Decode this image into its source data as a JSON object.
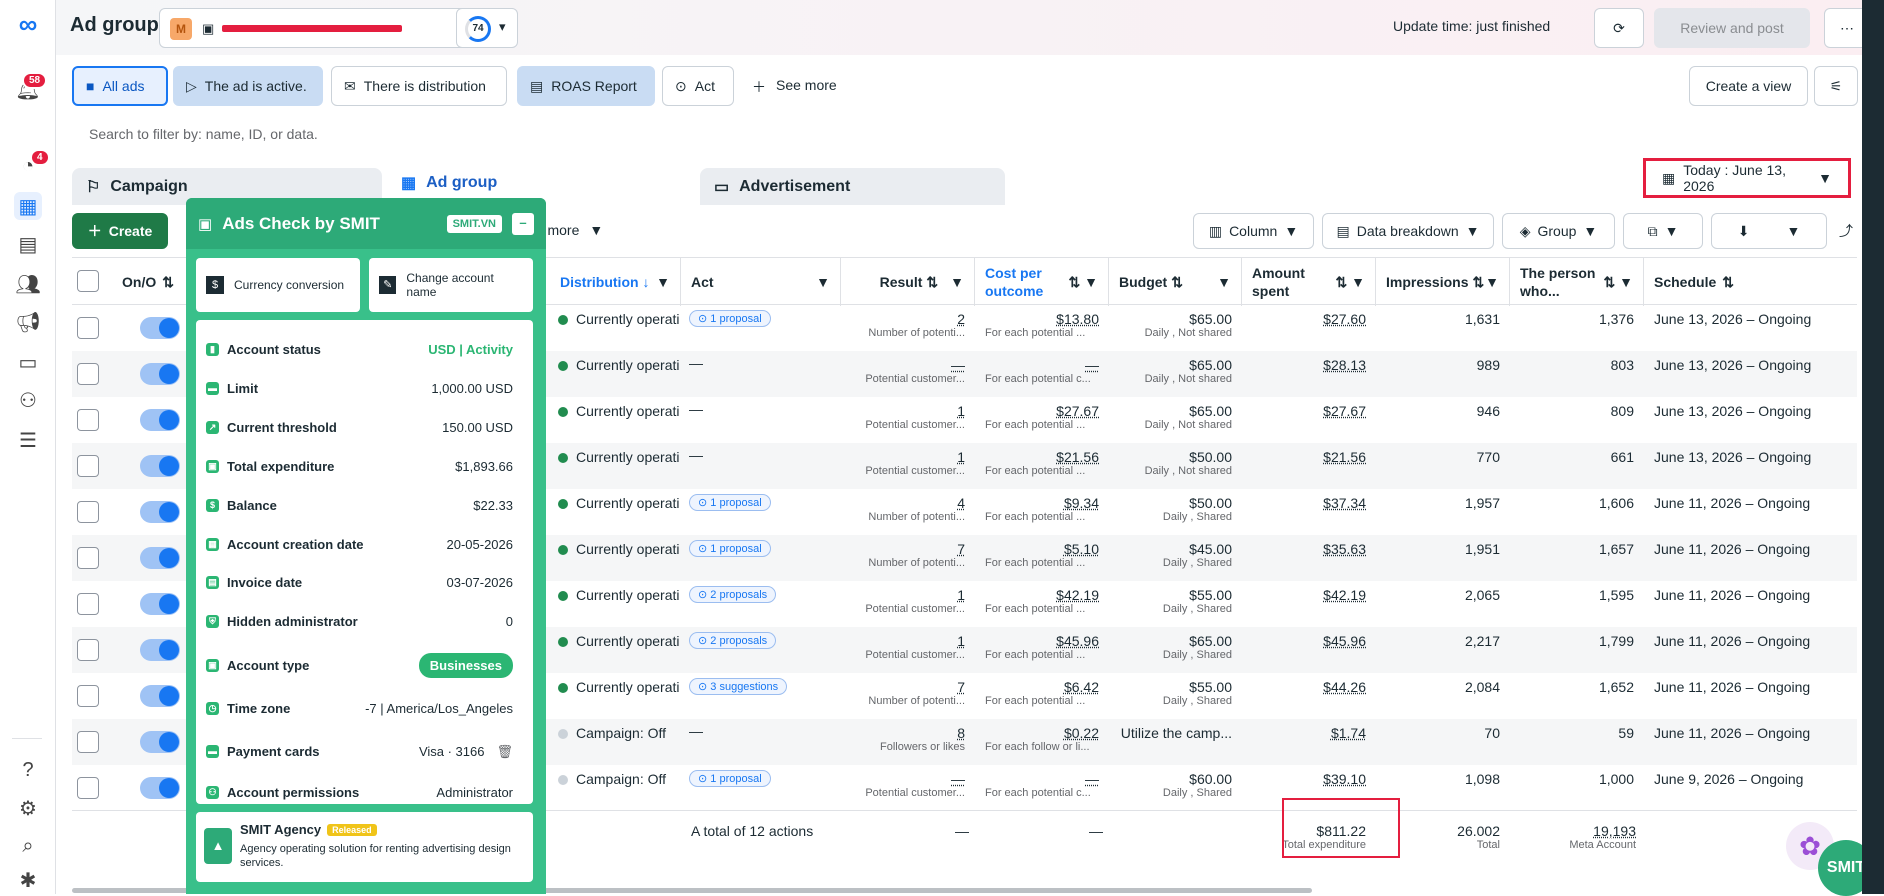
{
  "leftnav": {
    "notifications_badge": "58",
    "alerts_badge": "4"
  },
  "header": {
    "title": "Ad group",
    "account_initial": "M",
    "score": "74",
    "update_time": "Update time: just finished",
    "review_post": "Review and post"
  },
  "filters": {
    "chips": [
      "All ads",
      "The ad is active.",
      "There is distribution",
      "ROAS Report",
      "Act"
    ],
    "see_more": "See more",
    "create_view": "Create a view"
  },
  "search": {
    "placeholder": "Search to filter by: name, ID, or data."
  },
  "tabs": {
    "campaign": "Campaign",
    "adgroup": "Ad group",
    "advertisement": "Advertisement"
  },
  "date": "Today : June 13, 2026",
  "toolbar": {
    "create": "Create",
    "see_more": "ee more",
    "column": "Column",
    "data_breakdown": "Data breakdown",
    "group": "Group"
  },
  "table": {
    "headers": {
      "onoff": "On/O",
      "distribution": "Distribution",
      "act": "Act",
      "result": "Result",
      "cpr": "Cost per outcome",
      "budget": "Budget",
      "amount": "Amount spent",
      "impressions": "Impressions",
      "person": "The person who...",
      "schedule": "Schedule"
    },
    "rows": [
      {
        "dist": "Currently operati",
        "on": true,
        "act": "1 proposal",
        "result": "2",
        "result_sub": "Number of potenti...",
        "cpr": "$13.80",
        "cpr_sub": "For each potential ...",
        "budget": "$65.00",
        "budget_sub": "Daily , Not shared",
        "amount": "$27.60",
        "impr": "1,631",
        "person": "1,376",
        "sched": "June 13, 2026 – Ongoing"
      },
      {
        "dist": "Currently operati",
        "on": true,
        "act": "—",
        "result": "—",
        "result_sub": "Potential customer...",
        "cpr": "—",
        "cpr_sub": "For each potential c...",
        "budget": "$65.00",
        "budget_sub": "Daily , Not shared",
        "amount": "$28.13",
        "impr": "989",
        "person": "803",
        "sched": "June 13, 2026 – Ongoing"
      },
      {
        "dist": "Currently operati",
        "on": true,
        "act": "—",
        "result": "1",
        "result_sub": "Potential customer...",
        "cpr": "$27.67",
        "cpr_sub": "For each potential ...",
        "budget": "$65.00",
        "budget_sub": "Daily , Not shared",
        "amount": "$27.67",
        "impr": "946",
        "person": "809",
        "sched": "June 13, 2026 – Ongoing"
      },
      {
        "dist": "Currently operati",
        "on": true,
        "act": "—",
        "result": "1",
        "result_sub": "Potential customer...",
        "cpr": "$21.56",
        "cpr_sub": "For each potential ...",
        "budget": "$50.00",
        "budget_sub": "Daily , Not shared",
        "amount": "$21.56",
        "impr": "770",
        "person": "661",
        "sched": "June 13, 2026 – Ongoing"
      },
      {
        "dist": "Currently operati",
        "on": true,
        "act": "1 proposal",
        "result": "4",
        "result_sub": "Number of potenti...",
        "cpr": "$9.34",
        "cpr_sub": "For each potential ...",
        "budget": "$50.00",
        "budget_sub": "Daily , Shared",
        "amount": "$37.34",
        "impr": "1,957",
        "person": "1,606",
        "sched": "June 11, 2026 – Ongoing"
      },
      {
        "dist": "Currently operati",
        "on": true,
        "act": "1 proposal",
        "result": "7",
        "result_sub": "Number of potenti...",
        "cpr": "$5.10",
        "cpr_sub": "For each potential ...",
        "budget": "$45.00",
        "budget_sub": "Daily , Shared",
        "amount": "$35.63",
        "impr": "1,951",
        "person": "1,657",
        "sched": "June 11, 2026 – Ongoing"
      },
      {
        "dist": "Currently operati",
        "on": true,
        "act": "2 proposals",
        "result": "1",
        "result_sub": "Potential customer...",
        "cpr": "$42.19",
        "cpr_sub": "For each potential ...",
        "budget": "$55.00",
        "budget_sub": "Daily , Shared",
        "amount": "$42.19",
        "impr": "2,065",
        "person": "1,595",
        "sched": "June 11, 2026 – Ongoing"
      },
      {
        "dist": "Currently operati",
        "on": true,
        "act": "2 proposals",
        "result": "1",
        "result_sub": "Potential customer...",
        "cpr": "$45.96",
        "cpr_sub": "For each potential ...",
        "budget": "$65.00",
        "budget_sub": "Daily , Shared",
        "amount": "$45.96",
        "impr": "2,217",
        "person": "1,799",
        "sched": "June 11, 2026 – Ongoing"
      },
      {
        "dist": "Currently operati",
        "on": true,
        "act": "3 suggestions",
        "result": "7",
        "result_sub": "Number of potenti...",
        "cpr": "$6.42",
        "cpr_sub": "For each potential ...",
        "budget": "$55.00",
        "budget_sub": "Daily , Shared",
        "amount": "$44.26",
        "impr": "2,084",
        "person": "1,652",
        "sched": "June 11, 2026 – Ongoing"
      },
      {
        "dist": "Campaign: Off",
        "on": false,
        "act": "—",
        "result": "8",
        "result_sub": "Followers or likes",
        "cpr": "$0.22",
        "cpr_sub": "For each follow or li...",
        "budget": "Utilize the camp...",
        "budget_sub": "",
        "amount": "$1.74",
        "impr": "70",
        "person": "59",
        "sched": "June 11, 2026 – Ongoing"
      },
      {
        "dist": "Campaign: Off",
        "on": false,
        "act": "1 proposal",
        "result": "—",
        "result_sub": "Potential customer...",
        "cpr": "—",
        "cpr_sub": "For each potential c...",
        "budget": "$60.00",
        "budget_sub": "Daily , Shared",
        "amount": "$39.10",
        "impr": "1,098",
        "person": "1,000",
        "sched": "June 9, 2026 – Ongoing"
      }
    ],
    "total": {
      "label": "A total of 12 actions",
      "result": "—",
      "cpr": "—",
      "amount": "$811.22",
      "amount_sub": "Total expenditure",
      "impr": "26.002",
      "impr_sub": "Total",
      "person": "19,193",
      "person_sub": "Meta Account"
    }
  },
  "smit": {
    "title": "Ads Check by SMIT",
    "brand_tag": "SMIT.VN",
    "btn_currency": "Currency conversion",
    "btn_rename": "Change account name",
    "rows": [
      {
        "label": "Account status",
        "value": "USD | Activity"
      },
      {
        "label": "Limit",
        "value": "1,000.00 USD"
      },
      {
        "label": "Current threshold",
        "value": "150.00 USD"
      },
      {
        "label": "Total expenditure",
        "value": "$1,893.66"
      },
      {
        "label": "Balance",
        "value": "$22.33"
      },
      {
        "label": "Account creation date",
        "value": "20-05-2026"
      },
      {
        "label": "Invoice date",
        "value": "03-07-2026"
      },
      {
        "label": "Hidden administrator",
        "value": "0"
      },
      {
        "label": "Account type",
        "value": "Businesses"
      },
      {
        "label": "Time zone",
        "value": "-7 | America/Los_Angeles"
      },
      {
        "label": "Payment cards",
        "value": "Visa · 3166"
      },
      {
        "label": "Account permissions",
        "value": "Administrator"
      }
    ],
    "agency_title": "SMIT Agency",
    "agency_tag": "Released",
    "agency_desc": "Agency operating solution for renting advertising design services.",
    "fab_label": "SMIT"
  },
  "colors": {
    "accent": "#1877f2",
    "smit_green": "#39c08a",
    "danger": "#e41e3f"
  }
}
